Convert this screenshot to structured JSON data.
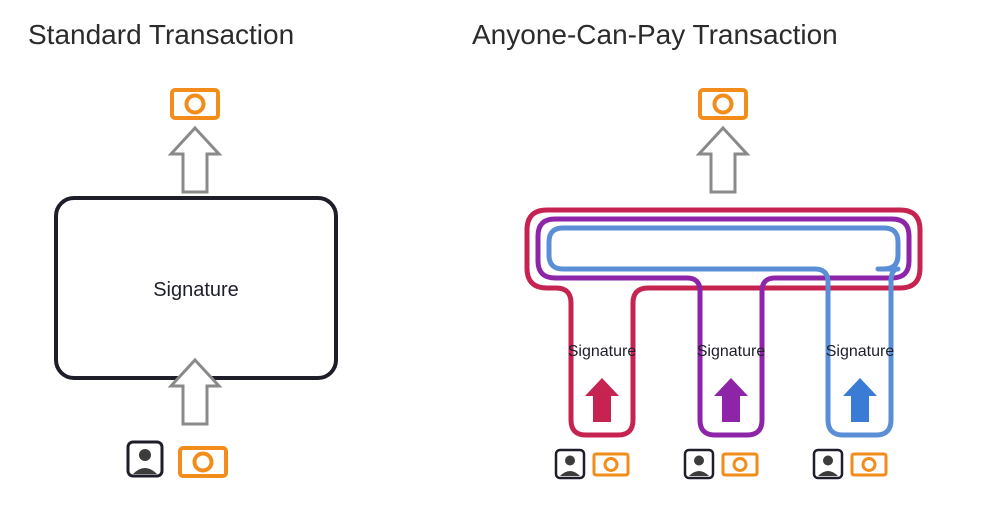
{
  "left": {
    "title": "Standard Transaction",
    "signature_label": "Signature"
  },
  "right": {
    "title": "Anyone-Can-Pay Transaction",
    "contributors": [
      {
        "signature_label": "Signature",
        "color": "#c62350"
      },
      {
        "signature_label": "Signature",
        "color": "#8e25a8"
      },
      {
        "signature_label": "Signature",
        "color": "#3a7bd5"
      }
    ]
  },
  "colors": {
    "money": "#f28c1a",
    "arrow_gray": "#8a8a8a",
    "ink": "#1e1e2a",
    "user": "#3c3c3c"
  }
}
